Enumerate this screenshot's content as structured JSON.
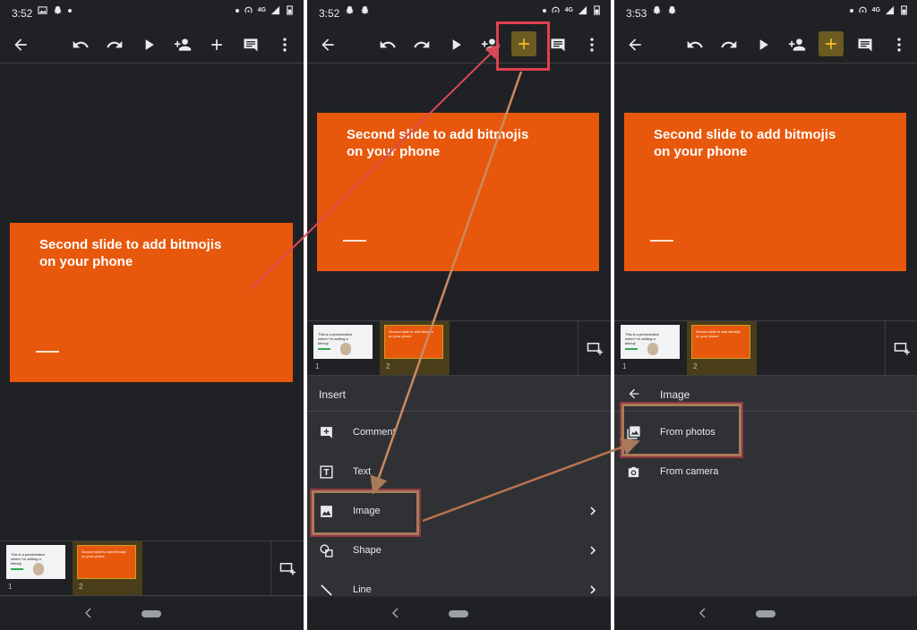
{
  "status": {
    "time1": "3:52",
    "time2": "3:52",
    "time3": "3:53",
    "network": "4G"
  },
  "slide": {
    "title_line1": "Second slide to add bitmojis",
    "title_line2": "on your phone"
  },
  "filmstrip": {
    "thumb1_text": "This is a presentation where I'm adding a bitmoji",
    "thumb2_text": "Second slide to add bitmojis on your phone",
    "num1": "1",
    "num2": "2"
  },
  "insert_menu": {
    "title": "Insert",
    "items": [
      {
        "label": "Comment",
        "icon": "add-comment-icon"
      },
      {
        "label": "Text",
        "icon": "text-box-icon"
      },
      {
        "label": "Image",
        "icon": "image-icon"
      },
      {
        "label": "Shape",
        "icon": "shape-icon"
      },
      {
        "label": "Line",
        "icon": "line-icon"
      }
    ]
  },
  "image_menu": {
    "title": "Image",
    "items": [
      {
        "label": "From photos",
        "icon": "photo-library-icon"
      },
      {
        "label": "From camera",
        "icon": "camera-icon"
      }
    ]
  },
  "colors": {
    "background": "#202124",
    "slide": "#e8580c",
    "accent_add": "#f6c026",
    "highlight": "#e04050"
  }
}
